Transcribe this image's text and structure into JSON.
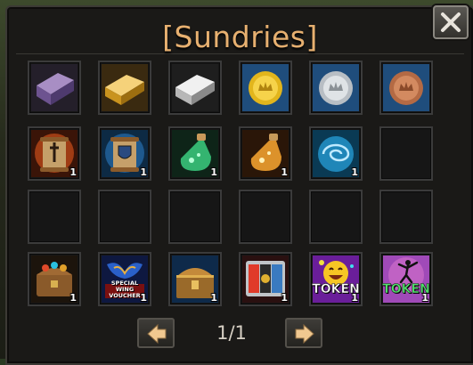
{
  "window": {
    "title": "[Sundries]"
  },
  "inventory": {
    "slots": [
      {
        "item": "amethyst-ingot-icon",
        "qty": ""
      },
      {
        "item": "gold-ingot-icon",
        "qty": ""
      },
      {
        "item": "silver-ingot-icon",
        "qty": ""
      },
      {
        "item": "gold-coin-icon",
        "qty": ""
      },
      {
        "item": "silver-coin-icon",
        "qty": ""
      },
      {
        "item": "bronze-coin-icon",
        "qty": ""
      },
      {
        "item": "sword-scroll-icon",
        "qty": "1"
      },
      {
        "item": "shield-scroll-icon",
        "qty": "1"
      },
      {
        "item": "green-potion-icon",
        "qty": "1"
      },
      {
        "item": "amber-potion-icon",
        "qty": "1"
      },
      {
        "item": "vortex-orb-icon",
        "qty": "1"
      },
      {
        "item": "empty",
        "qty": ""
      },
      {
        "item": "empty",
        "qty": ""
      },
      {
        "item": "empty",
        "qty": ""
      },
      {
        "item": "empty",
        "qty": ""
      },
      {
        "item": "empty",
        "qty": ""
      },
      {
        "item": "empty",
        "qty": ""
      },
      {
        "item": "empty",
        "qty": ""
      },
      {
        "item": "gem-chest-icon",
        "qty": "1"
      },
      {
        "item": "wing-voucher-icon",
        "qty": "1",
        "caption_line1": "SPECIAL",
        "caption_line2": "WING VOUCHER"
      },
      {
        "item": "treasure-chest-icon",
        "qty": "1"
      },
      {
        "item": "slot-reels-icon",
        "qty": "1"
      },
      {
        "item": "emoji-token-icon",
        "qty": "1",
        "caption": "TOKEN"
      },
      {
        "item": "dance-token-icon",
        "qty": "1",
        "caption": "TOKEN"
      }
    ]
  },
  "pagination": {
    "indicator": "1/1"
  },
  "colors": {
    "title": "#e7b070",
    "panel": "#1a1917",
    "slot_border": "#3b3b3b"
  }
}
